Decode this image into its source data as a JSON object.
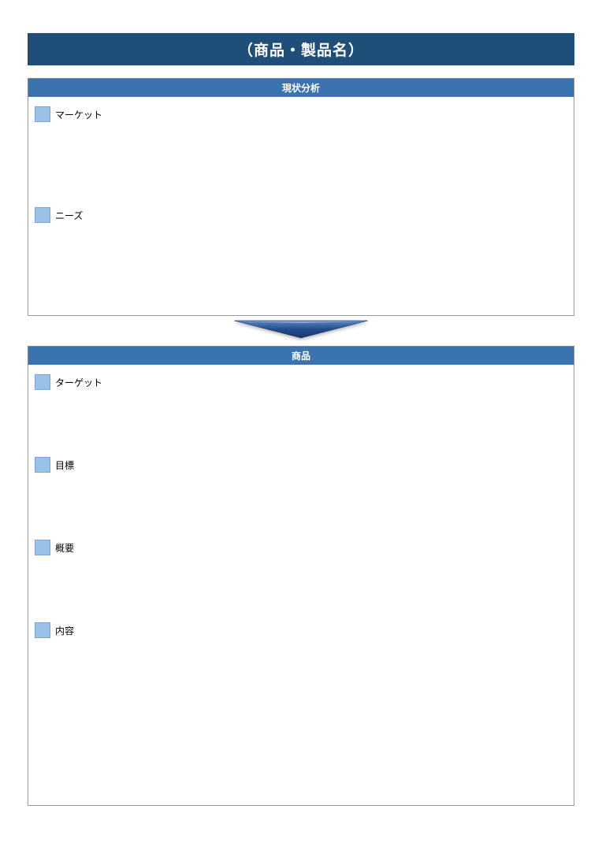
{
  "title": "（商品・製品名）",
  "section1": {
    "header": "現状分析",
    "items": [
      {
        "label": "マーケット"
      },
      {
        "label": "ニーズ"
      }
    ]
  },
  "section2": {
    "header": "商品",
    "items": [
      {
        "label": "ターゲット"
      },
      {
        "label": "目標"
      },
      {
        "label": "概要"
      },
      {
        "label": "内容"
      }
    ]
  },
  "colors": {
    "titleBg": "#1f4e79",
    "headerBg": "#3b72b0",
    "bullet": "#9ac2e6"
  }
}
